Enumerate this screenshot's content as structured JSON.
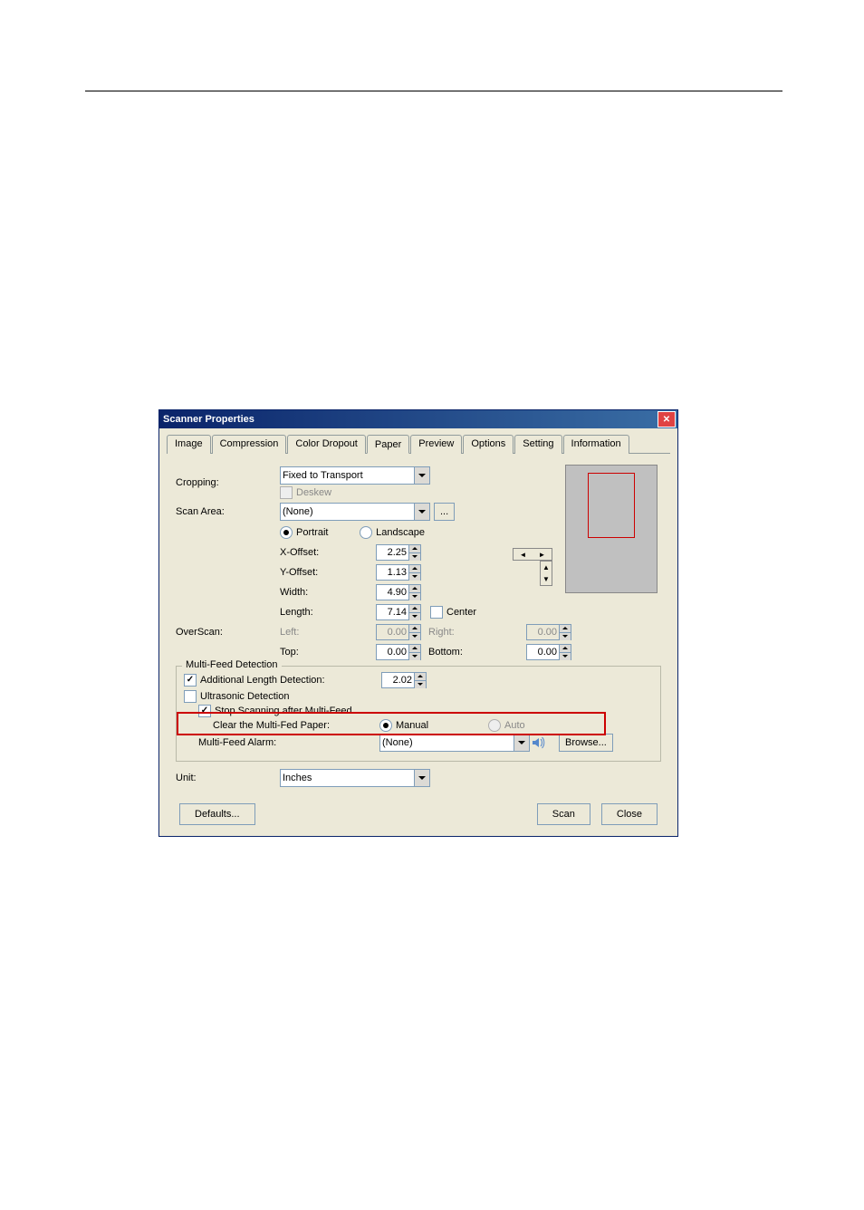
{
  "dialog": {
    "title": "Scanner Properties",
    "tabs": [
      "Image",
      "Compression",
      "Color Dropout",
      "Paper",
      "Preview",
      "Options",
      "Setting",
      "Information"
    ],
    "active_tab_index": 3,
    "cropping": {
      "label": "Cropping:",
      "value": "Fixed to Transport",
      "deskew_label": "Deskew"
    },
    "scan_area": {
      "label": "Scan Area:",
      "value": "(None)",
      "more": "...",
      "portrait": "Portrait",
      "landscape": "Landscape",
      "xoffset_label": "X-Offset:",
      "xoffset": "2.25",
      "yoffset_label": "Y-Offset:",
      "yoffset": "1.13",
      "width_label": "Width:",
      "width": "4.90",
      "length_label": "Length:",
      "length": "7.14",
      "center_label": "Center"
    },
    "overscan": {
      "label": "OverScan:",
      "left_label": "Left:",
      "left": "0.00",
      "right_label": "Right:",
      "right": "0.00",
      "top_label": "Top:",
      "top": "0.00",
      "bottom_label": "Bottom:",
      "bottom": "0.00"
    },
    "multifeed": {
      "legend": "Multi-Feed Detection",
      "ald_label": "Additional Length Detection:",
      "ald_value": "2.02",
      "ultrasonic_label": "Ultrasonic Detection",
      "stop_label": "Stop Scanning after Multi-Feed",
      "clear_label": "Clear the Multi-Fed Paper:",
      "manual": "Manual",
      "auto": "Auto",
      "alarm_label": "Multi-Feed Alarm:",
      "alarm_value": "(None)",
      "browse": "Browse..."
    },
    "unit": {
      "label": "Unit:",
      "value": "Inches"
    },
    "buttons": {
      "defaults": "Defaults...",
      "scan": "Scan",
      "close": "Close"
    }
  }
}
